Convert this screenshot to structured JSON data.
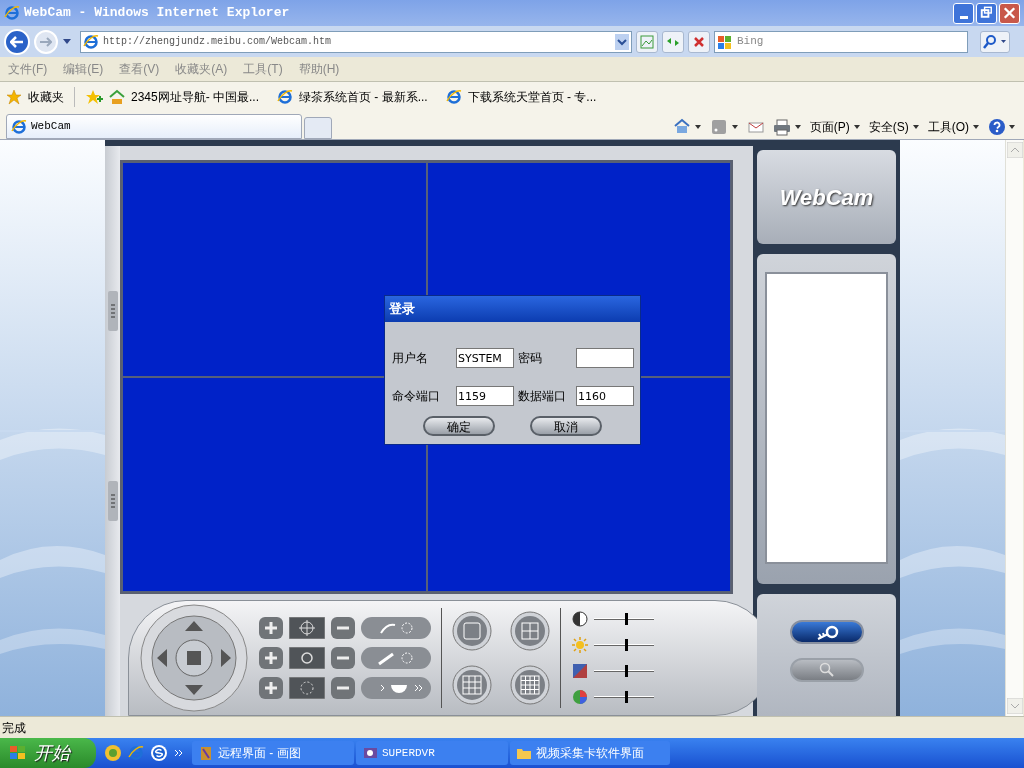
{
  "window": {
    "title": "WebCam - Windows Internet Explorer"
  },
  "address_bar": {
    "url": "http://zhengjundz.meibu.com/Webcam.htm",
    "search_placeholder": "Bing"
  },
  "menu": [
    "文件(F)",
    "编辑(E)",
    "查看(V)",
    "收藏夹(A)",
    "工具(T)",
    "帮助(H)"
  ],
  "favorites": {
    "label": "收藏夹",
    "links": [
      "2345网址导航- 中国最...",
      "绿茶系统首页 - 最新系...",
      "下载系统天堂首页 - 专..."
    ]
  },
  "tabs": [
    {
      "label": "WebCam",
      "selected": true
    }
  ],
  "command_bar": [
    "页面(P)",
    "安全(S)",
    "工具(O)"
  ],
  "app": {
    "logo": "WebCam",
    "login_dialog": {
      "title": "登录",
      "fields": [
        {
          "label": "用户名",
          "value": "SYSTEM"
        },
        {
          "label": "密码"
        },
        {
          "label": "命令端口",
          "value": "1159"
        },
        {
          "label": "数据端口",
          "value": "1160"
        }
      ],
      "buttons": [
        "确定",
        "取消"
      ]
    },
    "sliders": [
      {
        "kind": "contrast",
        "level": 0.55
      },
      {
        "kind": "brightness",
        "level": 0.55
      },
      {
        "kind": "saturation",
        "level": 0.55
      },
      {
        "kind": "hue",
        "level": 0.55
      }
    ]
  },
  "status_bar": "完成",
  "taskbar": {
    "start": "开始",
    "tasks": [
      {
        "label": "远程界面 - 画图",
        "selected": false
      },
      {
        "label": "SUPERDVR",
        "selected": false
      },
      {
        "label": "视频采集卡软件界面",
        "selected": false
      }
    ]
  }
}
